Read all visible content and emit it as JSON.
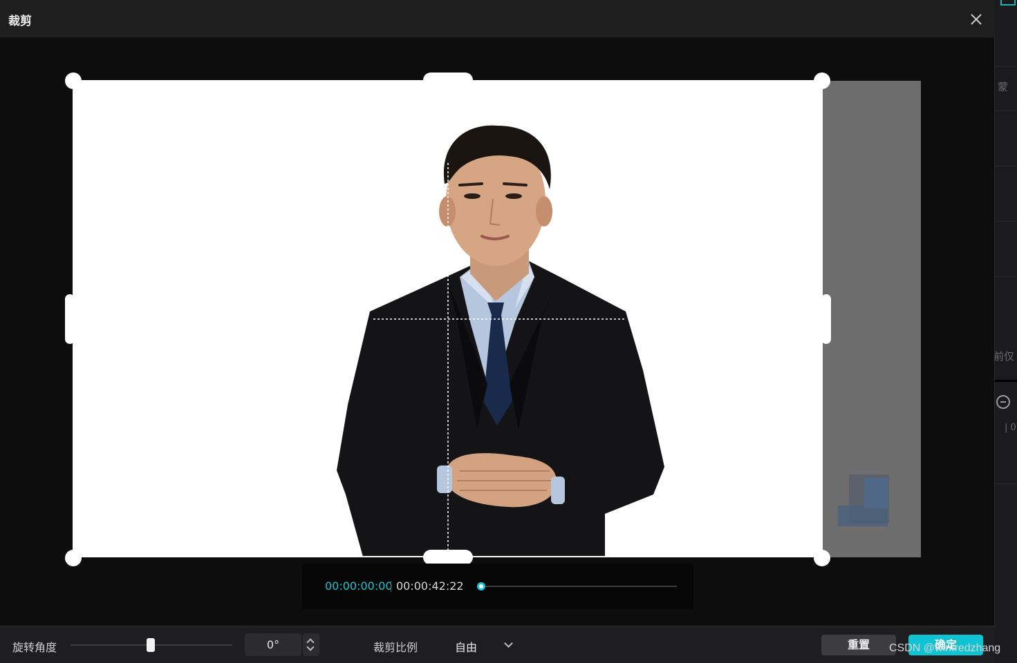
{
  "dialog": {
    "title": "裁剪",
    "close_icon": "close-icon"
  },
  "timeline": {
    "current_time": "00:00:00:00",
    "total_time": "00:00:42:22",
    "progress": 0.0
  },
  "controls": {
    "rotation_label": "旋转角度",
    "rotation_value": "0°",
    "ratio_label": "裁剪比例",
    "ratio_value": "自由",
    "reset_label": "重置",
    "confirm_label": "确定"
  },
  "background_strip": {
    "fragments": [
      "蒙",
      "前仅",
      "| 0"
    ]
  },
  "watermark": "CSDN @winfredzhang",
  "colors": {
    "accent": "#10c3d3",
    "timecode_accent": "#1ec4d2",
    "dialog_bg": "#0d0d0d",
    "toolbar_bg": "#1e1e20"
  }
}
